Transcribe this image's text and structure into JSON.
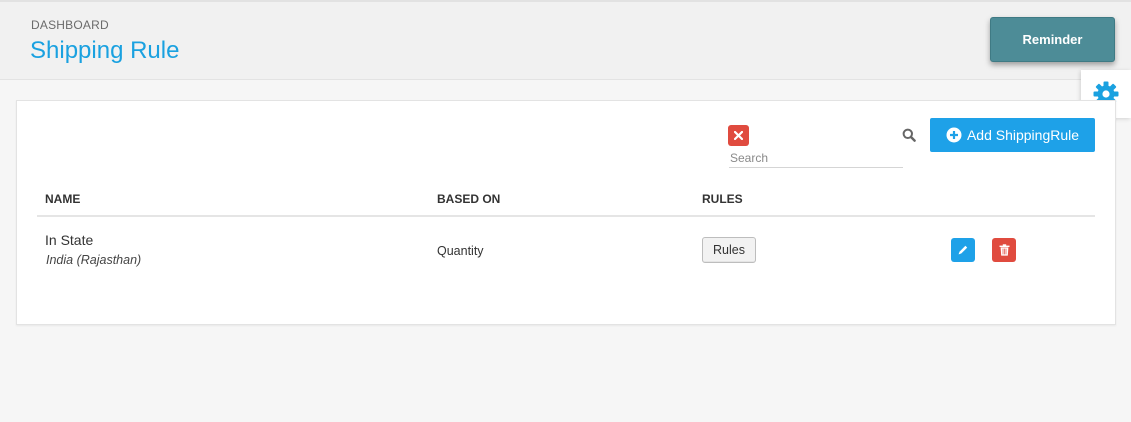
{
  "header": {
    "breadcrumb": "DASHBOARD",
    "title": "Shipping Rule",
    "reminder_label": "Reminder"
  },
  "toolbar": {
    "search_placeholder": "Search",
    "add_label": "Add ShippingRule"
  },
  "table": {
    "columns": [
      "NAME",
      "BASED ON",
      "RULES"
    ],
    "rows": [
      {
        "name": "In State",
        "location": "India (Rajasthan)",
        "based_on": "Quantity",
        "rules_label": "Rules"
      }
    ]
  },
  "colors": {
    "accent": "#1aa1e0",
    "primary_button": "#1ea1e8",
    "danger": "#e04b3f",
    "reminder": "#4d8c97"
  },
  "icons": {
    "settings": "gear-icon",
    "clear": "close-icon",
    "search": "search-icon",
    "add": "plus-circle-icon",
    "edit": "pencil-icon",
    "delete": "trash-icon"
  }
}
